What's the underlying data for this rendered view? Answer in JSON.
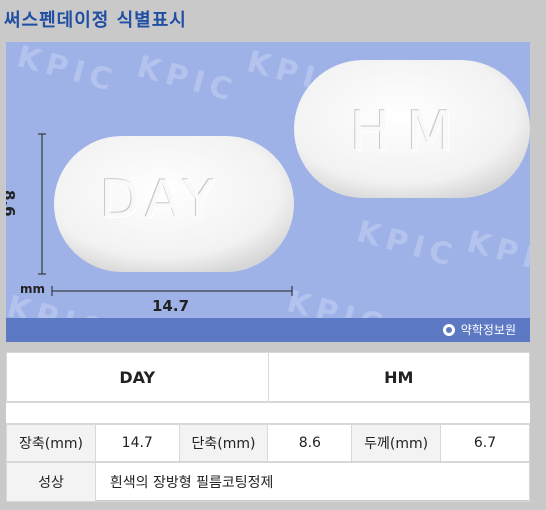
{
  "page_title": "써스펜데이정 식별표시",
  "image": {
    "front_mark": "DAY",
    "back_mark": "HM",
    "width_label": "8.6",
    "length_label": "14.7",
    "unit_label": "mm",
    "watermark": "KPIC",
    "provider": "약학정보원"
  },
  "table": {
    "marks": [
      "DAY",
      "HM"
    ],
    "dims": [
      {
        "label": "장축(mm)",
        "value": "14.7"
      },
      {
        "label": "단축(mm)",
        "value": "8.6"
      },
      {
        "label": "두께(mm)",
        "value": "6.7"
      }
    ],
    "shape_label": "성상",
    "shape_value": "흰색의 장방형 필름코팅정제"
  },
  "colors": {
    "title": "#1f4ea3",
    "photo_bg": "#9fb2e8",
    "footer": "#5d79c4"
  }
}
